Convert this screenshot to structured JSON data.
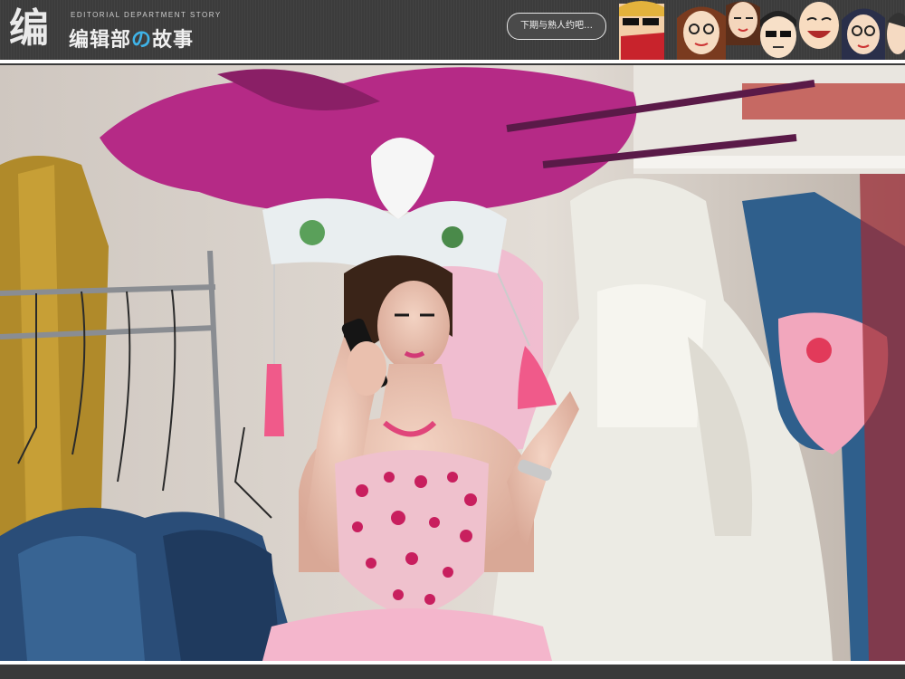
{
  "header": {
    "logo_mark": "编",
    "logo_subtitle": "EDITORIAL DEPARTMENT STORY",
    "logo_title_a": "编辑部",
    "logo_title_no": "の",
    "logo_title_b": "故事",
    "speech_bubble": "下期与熟人约吧…",
    "character_icons": [
      "sunglasses-face",
      "glasses-woman-face",
      "glasses-woman-face",
      "smiling-face",
      "glasses-man-face",
      "laughing-face",
      "glasses-woman-face",
      "partial-face"
    ]
  },
  "photo": {
    "subject": "showgirl-with-phone",
    "colors": {
      "feathers": "#b52a86",
      "background_wall": "#ddd6cf",
      "white_dress": "#ecebe4",
      "blue_costume": "#2a4d78",
      "gold_dress": "#b08a2a",
      "pink_tassel": "#f05a8a"
    }
  }
}
